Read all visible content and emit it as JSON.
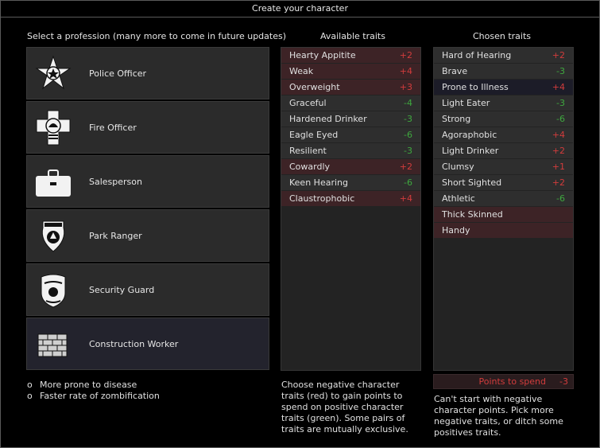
{
  "window": {
    "title": "Create your character"
  },
  "professions": {
    "header": "Select a profession (many more to come in future updates)",
    "items": [
      {
        "label": "Police Officer",
        "icon": "police-badge-icon"
      },
      {
        "label": "Fire Officer",
        "icon": "fire-badge-icon"
      },
      {
        "label": "Salesperson",
        "icon": "briefcase-icon"
      },
      {
        "label": "Park Ranger",
        "icon": "ranger-badge-icon"
      },
      {
        "label": "Security Guard",
        "icon": "security-badge-icon"
      },
      {
        "label": "Construction Worker",
        "icon": "bricks-icon"
      }
    ],
    "selected": "Construction Worker",
    "effects": [
      "More prone to disease",
      "Faster rate of zombification"
    ]
  },
  "available_traits": {
    "header": "Available traits",
    "items": [
      {
        "name": "Hearty Appitite",
        "cost": "+2",
        "type": "neg"
      },
      {
        "name": "Weak",
        "cost": "+4",
        "type": "neg"
      },
      {
        "name": "Overweight",
        "cost": "+3",
        "type": "neg"
      },
      {
        "name": "Graceful",
        "cost": "-4",
        "type": "pos"
      },
      {
        "name": "Hardened Drinker",
        "cost": "-3",
        "type": "pos"
      },
      {
        "name": "Eagle Eyed",
        "cost": "-6",
        "type": "pos"
      },
      {
        "name": "Resilient",
        "cost": "-3",
        "type": "pos"
      },
      {
        "name": "Cowardly",
        "cost": "+2",
        "type": "neg"
      },
      {
        "name": "Keen Hearing",
        "cost": "-6",
        "type": "pos"
      },
      {
        "name": "Claustrophobic",
        "cost": "+4",
        "type": "neg"
      }
    ],
    "description": "Choose negative character traits (red) to gain points to spend on positive character traits (green). Some pairs of traits are mutually exclusive."
  },
  "chosen_traits": {
    "header": "Chosen traits",
    "items": [
      {
        "name": "Hard of Hearing",
        "cost": "+2",
        "type": "pos"
      },
      {
        "name": "Brave",
        "cost": "-3",
        "type": "pos"
      },
      {
        "name": "Prone to Illness",
        "cost": "+4",
        "type": "hl"
      },
      {
        "name": "Light Eater",
        "cost": "-3",
        "type": "pos"
      },
      {
        "name": "Strong",
        "cost": "-6",
        "type": "pos"
      },
      {
        "name": "Agoraphobic",
        "cost": "+4",
        "type": "pos"
      },
      {
        "name": "Light Drinker",
        "cost": "+2",
        "type": "pos"
      },
      {
        "name": "Clumsy",
        "cost": "+1",
        "type": "pos"
      },
      {
        "name": "Short Sighted",
        "cost": "+2",
        "type": "pos"
      },
      {
        "name": "Athletic",
        "cost": "-6",
        "type": "pos"
      },
      {
        "name": "Thick Skinned",
        "cost": "",
        "type": "neg"
      },
      {
        "name": "Handy",
        "cost": "",
        "type": "neg"
      }
    ],
    "points_label": "Points to spend",
    "points_value": "-3",
    "warning": "Can't start with negative character points. Pick more negative traits, or ditch some positives traits."
  },
  "colors": {
    "negative": "#d23c3c",
    "positive": "#3fa83f",
    "neg_row": "#3d2326"
  }
}
